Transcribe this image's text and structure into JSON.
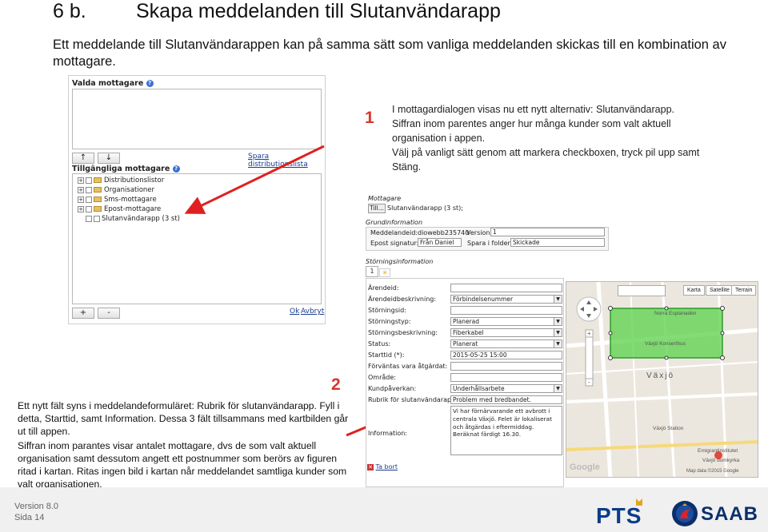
{
  "slide": {
    "number": "6 b.",
    "title": "Skapa meddelanden till Slutanvändarapp",
    "intro": "Ett meddelande till Slutanvändarappen kan på samma sätt som vanliga meddelanden skickas till en kombination av mottagare."
  },
  "dialog": {
    "selected_header": "Valda mottagare",
    "up_button": "↑",
    "down_button": "↓",
    "save_list_link": "Spara distributionslista",
    "available_header": "Tillgängliga mottagare",
    "tree": [
      {
        "label": "Distributionslistor",
        "kind": "folder"
      },
      {
        "label": "Organisationer",
        "kind": "folder"
      },
      {
        "label": "Sms-mottagare",
        "kind": "folder"
      },
      {
        "label": "Epost-mottagare",
        "kind": "folder"
      },
      {
        "label": "Slutanvändarapp (3 st)",
        "kind": "checkbox"
      }
    ],
    "add_button": "+",
    "remove_button": "-",
    "ok_link": "Ok",
    "cancel_link": "Avbryt"
  },
  "step1": {
    "number": "1",
    "text1": "I mottagardialogen visas nu ett nytt alternativ: Slutanvändarapp. Siffran inom parentes anger hur många kunder som valt aktuell organisation i appen.",
    "text2": "Välj på vanligt sätt genom att markera checkboxen, tryck pil upp samt Stäng."
  },
  "step2": {
    "number": "2",
    "text1": "Ett nytt fält syns i meddelandeformuläret: Rubrik för slutanvändarapp. Fyll i detta, Starttid, samt Information. Dessa 3 fält tillsammans med kartbilden går ut till appen.",
    "text2": "Siffran inom parantes visar antalet mottagare, dvs de som valt aktuell organisation samt dessutom angett ett postnummer som berörs av figuren ritad i kartan. Ritas ingen bild i kartan når meddelandet samtliga kunder som valt organisationen."
  },
  "form": {
    "mottagare_title": "Mottagare",
    "till_button": "Till...",
    "till_value": "Slutanvändarapp (3 st);",
    "grund_title": "Grundinformation",
    "meddelandeid_label": "Meddelandeid:",
    "meddelandeid_value": "diowebb235740",
    "version_label": "Version:",
    "version_value": "1",
    "epost_label": "Epost signatur:",
    "epost_value": "Från Daniel",
    "spara_label": "Spara i folder:",
    "spara_value": "Skickade",
    "storning_title": "Störningsinformation",
    "tab1": "1",
    "tab_new": "✳",
    "fields": [
      {
        "label": "Ärendeid:",
        "value": ""
      },
      {
        "label": "Ärendeidbeskrivning:",
        "value": "Förbindelsenummer",
        "dropdown": true
      },
      {
        "label": "Störningsid:",
        "value": ""
      },
      {
        "label": "Störningstyp:",
        "value": "Planerad",
        "dropdown": true
      },
      {
        "label": "Störningsbeskrivning:",
        "value": "Fiberkabel",
        "dropdown": true
      },
      {
        "label": "Status:",
        "value": "Planerat",
        "dropdown": true
      },
      {
        "label": "Starttid (*):",
        "value": "2015-05-25 15:00"
      },
      {
        "label": "Förväntas vara åtgärdat:",
        "value": ""
      },
      {
        "label": "Område:",
        "value": ""
      },
      {
        "label": "Kundpåverkan:",
        "value": "Underhållsarbete",
        "dropdown": true
      },
      {
        "label": "Rubrik för slutanvändarapp:",
        "value": "Problem med bredbandet."
      }
    ],
    "information_label": "Information:",
    "information_value": "Vi har förnärvarande ett avbrott i centrala Växjö. Felet är lokaliserat och åtgärdas i eftermiddag. Beräknat färdigt 16.30.",
    "delete_link": "Ta bort"
  },
  "map": {
    "karta": "Karta",
    "satellite": "Satellite",
    "terrain": "Terrain",
    "labels": [
      "Norra Esplanaden",
      "Växjö Konserthus",
      "Växjö",
      "Växjö Station",
      "Emigrantinstitutet",
      "Växjö domkyrka"
    ],
    "copyright": "Map data ©2015 Google",
    "google": "Google",
    "polygon_color": "#59d14a"
  },
  "footer": {
    "version": "Version 8.0",
    "page": "Sida  14",
    "pts_logo": "PTS",
    "saab_logo": "SAAB"
  },
  "colors": {
    "accent_red": "#d9352b",
    "arrow_red": "#e02020"
  }
}
